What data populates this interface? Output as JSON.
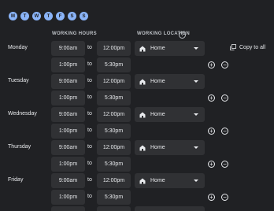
{
  "week_days": [
    "M",
    "T",
    "W",
    "T",
    "F",
    "S",
    "S"
  ],
  "headers": {
    "working_hours": "WORKING HOURS",
    "working_location": "WORKING LOCATION",
    "help_icon": "?"
  },
  "copy_to_all": "Copy to all",
  "to_label": "to",
  "days": [
    {
      "name": "Monday",
      "location": "Home",
      "slots": [
        {
          "start": "9:00am",
          "end": "12:00pm"
        },
        {
          "start": "1:00pm",
          "end": "5:30pm"
        }
      ]
    },
    {
      "name": "Tuesday",
      "location": "Home",
      "slots": [
        {
          "start": "9:00am",
          "end": "12:00pm"
        },
        {
          "start": "1:00pm",
          "end": "5:30pm"
        }
      ]
    },
    {
      "name": "Wednesday",
      "location": "Home",
      "slots": [
        {
          "start": "9:00am",
          "end": "12:00pm"
        },
        {
          "start": "1:00pm",
          "end": "5:30pm"
        }
      ]
    },
    {
      "name": "Thursday",
      "location": "Home",
      "slots": [
        {
          "start": "9:00am",
          "end": "12:00pm"
        },
        {
          "start": "1:00pm",
          "end": "5:30pm"
        }
      ]
    },
    {
      "name": "Friday",
      "location": "Home",
      "slots": [
        {
          "start": "9:00am",
          "end": "12:00pm"
        },
        {
          "start": "1:00pm",
          "end": "5:30pm"
        }
      ]
    }
  ],
  "icons": {
    "add": "add-circle-icon",
    "remove": "remove-circle-icon",
    "home": "home-icon",
    "copy": "copy-icon"
  },
  "colors": {
    "background": "#202124",
    "field": "#303134",
    "accent": "#8ab4f8",
    "text": "#e8eaed"
  }
}
